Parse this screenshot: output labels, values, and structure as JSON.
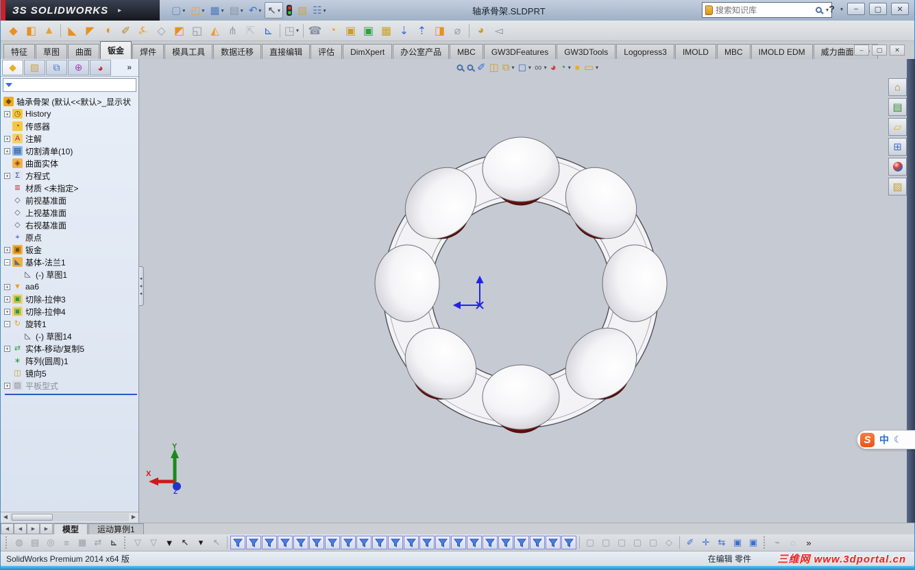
{
  "colors": {
    "accent_blue": "#2a57c8",
    "ball_red": "#8e1f17",
    "cage_white": "#f3f3f6",
    "viewport_bg": "#c6cad3",
    "titlebar_dark": "#15181f",
    "logo_red": "#cc2127",
    "watermark_red": "#e02828"
  },
  "titlebar": {
    "logo": "ЗS SOLIDWORKS",
    "logo_arrow": "▸",
    "title": "轴承骨架.SLDPRT",
    "search": {
      "placeholder": "搜索知识库"
    },
    "help": "?",
    "help_caret": "▾",
    "window_controls": {
      "minimize": "–",
      "restore": "▢",
      "close": "✕"
    }
  },
  "standard_toolbar": {
    "items": [
      {
        "name": "new-document",
        "g": "▢",
        "c": "#6a87b8",
        "caret": "▾"
      },
      {
        "name": "open",
        "g": "◰",
        "c": "#e8a33d",
        "caret": "▾"
      },
      {
        "name": "save",
        "g": "▦",
        "c": "#4f78c0",
        "caret": "▾"
      },
      {
        "name": "print",
        "g": "▤",
        "c": "#8a93a5",
        "caret": "▾"
      },
      {
        "name": "undo",
        "g": "↶",
        "c": "#3f6fd0",
        "caret": "▾"
      },
      {
        "name": "select",
        "g": "↖",
        "c": "#444a55",
        "caret": "▾",
        "boxed": true
      },
      {
        "name": "rebuild-traffic-light",
        "g": "",
        "c": "",
        "caret": "",
        "traffic": true
      },
      {
        "name": "file-properties",
        "g": "▧",
        "c": "#caa44a",
        "caret": ""
      },
      {
        "name": "options",
        "g": "☷",
        "c": "#5a79b5",
        "caret": "▾"
      }
    ]
  },
  "sheetmetal_toolbar": {
    "items": [
      {
        "name": "base-flange",
        "g": "◆",
        "c": "#e89020"
      },
      {
        "name": "convert-to-sheetmetal",
        "g": "◧",
        "c": "#e89020"
      },
      {
        "name": "lofted-bend",
        "g": "▲",
        "c": "#e8a030"
      },
      {
        "name": "sep",
        "g": "",
        "c": "",
        "sep": true
      },
      {
        "name": "edge-flange",
        "g": "◣",
        "c": "#e89020"
      },
      {
        "name": "miter-flange",
        "g": "◤",
        "c": "#e89020"
      },
      {
        "name": "hem",
        "g": "◖",
        "c": "#e89020"
      },
      {
        "name": "sketched-bend",
        "g": "✐",
        "c": "#b0882a"
      },
      {
        "name": "jog",
        "g": "⍼",
        "c": "#e8a030"
      },
      {
        "name": "swept-flange",
        "g": "◇",
        "c": "#98a0aa"
      },
      {
        "name": "cross-break",
        "g": "◩",
        "c": "#e89020"
      },
      {
        "name": "closed-corner",
        "g": "◱",
        "c": "#8a93a0"
      },
      {
        "name": "welded-corner",
        "g": "◭",
        "c": "#e8a030"
      },
      {
        "name": "corner-relief",
        "g": "⋔",
        "c": "#98a0aa"
      },
      {
        "name": "break-corner",
        "g": "⇱",
        "c": "#b8bec6"
      },
      {
        "name": "corner-trim",
        "g": "⊾",
        "c": "#3a6fd0"
      },
      {
        "name": "sep",
        "g": "",
        "c": "",
        "sep": true
      },
      {
        "name": "extruded-cut",
        "g": "◳",
        "c": "#98a0aa",
        "caret": "▾"
      },
      {
        "name": "sep",
        "g": "",
        "c": "",
        "sep": true
      },
      {
        "name": "simple-hole",
        "g": "☎",
        "c": "#8a93a0"
      },
      {
        "name": "vent",
        "g": "◔",
        "c": "#e8a030"
      },
      {
        "name": "unfold",
        "g": "▣",
        "c": "#c8a020"
      },
      {
        "name": "fold",
        "g": "▣",
        "c": "#30a040"
      },
      {
        "name": "flatten-pattern",
        "g": "▦",
        "c": "#c8a020"
      },
      {
        "name": "insert-bends",
        "g": "⇣",
        "c": "#3a6fd0"
      },
      {
        "name": "rip",
        "g": "⇡",
        "c": "#3a6fd0"
      },
      {
        "name": "no-bends",
        "g": "◨",
        "c": "#e89020"
      },
      {
        "name": "forming-tool",
        "g": "⌀",
        "c": "#98a0aa"
      },
      {
        "name": "sep",
        "g": "",
        "c": "",
        "sep": true
      },
      {
        "name": "sheet-metal-gusset",
        "g": "◕",
        "c": "#c8a020"
      },
      {
        "name": "tab-and-slot",
        "g": "◅",
        "c": "#8a93a0"
      }
    ]
  },
  "command_tabs": {
    "items": [
      {
        "label": "特征",
        "active": false
      },
      {
        "label": "草图",
        "active": false
      },
      {
        "label": "曲面",
        "active": false
      },
      {
        "label": "钣金",
        "active": true
      },
      {
        "label": "焊件",
        "active": false
      },
      {
        "label": "模具工具",
        "active": false
      },
      {
        "label": "数据迁移",
        "active": false
      },
      {
        "label": "直接编辑",
        "active": false
      },
      {
        "label": "评估",
        "active": false
      },
      {
        "label": "DimXpert",
        "active": false
      },
      {
        "label": "办公室产品",
        "active": false
      },
      {
        "label": "MBC",
        "active": false
      },
      {
        "label": "GW3DFeatures",
        "active": false
      },
      {
        "label": "GW3DTools",
        "active": false
      },
      {
        "label": "Logopress3",
        "active": false
      },
      {
        "label": "IMOLD",
        "active": false
      },
      {
        "label": "MBC",
        "active": false
      },
      {
        "label": "IMOLD EDM",
        "active": false
      },
      {
        "label": "威力曲面设计",
        "active": false
      }
    ]
  },
  "doc_controls": {
    "minimize": "–",
    "restore": "▢",
    "close": "✕"
  },
  "feature_tree": {
    "tabs": [
      {
        "name": "featuremanager-tab",
        "g": "◆",
        "c": "#e8b020",
        "active": true
      },
      {
        "name": "propertymanager-tab",
        "g": "▧",
        "c": "#caa44a",
        "active": false
      },
      {
        "name": "configurationmanager-tab",
        "g": "⧉",
        "c": "#4a78c8",
        "active": false
      },
      {
        "name": "dimxpertmanager-tab",
        "g": "⊕",
        "c": "#a040c0",
        "active": false
      },
      {
        "name": "displaymanager-tab",
        "g": "◕",
        "c": "#c03030",
        "active": false
      }
    ],
    "chevron": "»",
    "root_label": "轴承骨架  (默认<<默认>_显示状",
    "items": [
      {
        "expand": "+",
        "g": "◷",
        "bg": "#f5c842",
        "fg": "#7a4a00",
        "label": "History",
        "ml": 0
      },
      {
        "expand": "",
        "g": "◔",
        "bg": "#f5c842",
        "fg": "#7a4a00",
        "label": "传感器",
        "ml": 0
      },
      {
        "expand": "+",
        "g": "A",
        "bg": "#f5d06a",
        "fg": "#c02020",
        "label": "注解",
        "ml": 0
      },
      {
        "expand": "+",
        "g": "▤",
        "bg": "#86b4e8",
        "fg": "#1a3a6a",
        "label": "切割清单(10)",
        "ml": 0
      },
      {
        "expand": "",
        "g": "◈",
        "bg": "#f5b14a",
        "fg": "#8a4a00",
        "label": "曲面实体",
        "ml": 0
      },
      {
        "expand": "+",
        "g": "Σ",
        "bg": "#e2e6ee",
        "fg": "#2a4ab0",
        "label": "方程式",
        "ml": 0
      },
      {
        "expand": "",
        "g": "≣",
        "bg": "",
        "fg": "#c03030",
        "label": "材质 <未指定>",
        "ml": 0
      },
      {
        "expand": "",
        "g": "◇",
        "bg": "",
        "fg": "#4a5568",
        "label": "前视基准面",
        "ml": 0
      },
      {
        "expand": "",
        "g": "◇",
        "bg": "",
        "fg": "#4a5568",
        "label": "上视基准面",
        "ml": 0
      },
      {
        "expand": "",
        "g": "◇",
        "bg": "",
        "fg": "#4a5568",
        "label": "右视基准面",
        "ml": 0
      },
      {
        "expand": "",
        "g": "⌖",
        "bg": "",
        "fg": "#3050c8",
        "label": "原点",
        "ml": 0
      },
      {
        "expand": "+",
        "g": "▣",
        "bg": "#f0b23e",
        "fg": "#7a4a00",
        "label": "钣金",
        "ml": 0
      },
      {
        "expand": "−",
        "g": "◣",
        "bg": "#f0b23e",
        "fg": "#6a6f78",
        "label": "基体-法兰1",
        "ml": 0
      },
      {
        "expand": "",
        "g": "◺",
        "bg": "",
        "fg": "#3a424e",
        "label": "(-) 草图1",
        "ml": 16
      },
      {
        "expand": "+",
        "g": "▼",
        "bg": "",
        "fg": "#e8a020",
        "label": "aa6",
        "ml": 0
      },
      {
        "expand": "+",
        "g": "▣",
        "bg": "#f5d06a",
        "fg": "#2a9a3a",
        "label": "切除-拉伸3",
        "ml": 0
      },
      {
        "expand": "+",
        "g": "▣",
        "bg": "#f5d06a",
        "fg": "#2a9a3a",
        "label": "切除-拉伸4",
        "ml": 0
      },
      {
        "expand": "−",
        "g": "↻",
        "bg": "",
        "fg": "#e8a020",
        "label": "旋转1",
        "ml": 0
      },
      {
        "expand": "",
        "g": "◺",
        "bg": "",
        "fg": "#3a424e",
        "label": "(-) 草图14",
        "ml": 16
      },
      {
        "expand": "+",
        "g": "⇄",
        "bg": "",
        "fg": "#2a9a3a",
        "label": "实体-移动/复制5",
        "ml": 0
      },
      {
        "expand": "",
        "g": "∗",
        "bg": "",
        "fg": "#2a9a3a",
        "label": "阵列(圆周)1",
        "ml": 0
      },
      {
        "expand": "",
        "g": "◫",
        "bg": "",
        "fg": "#caa020",
        "label": "镜向5",
        "ml": 0
      },
      {
        "expand": "+",
        "g": "▨",
        "bg": "#d8dce2",
        "fg": "#8a9099",
        "label": "平板型式",
        "ml": 0,
        "gray": true
      }
    ]
  },
  "headsup": {
    "items": [
      {
        "name": "zoom-to-fit",
        "g": "",
        "c": "",
        "caret": "",
        "mag": true
      },
      {
        "name": "zoom-to-area",
        "g": "",
        "c": "",
        "caret": "",
        "mag": true
      },
      {
        "name": "magnified-selection",
        "g": "✐",
        "c": "#3a6fd0",
        "caret": ""
      },
      {
        "name": "section-view",
        "g": "◫",
        "c": "#caa030",
        "caret": ""
      },
      {
        "name": "view-orientation",
        "g": "⧉",
        "c": "#caa030",
        "caret": "▾"
      },
      {
        "name": "display-style",
        "g": "◻",
        "c": "#4a78c8",
        "caret": "▾"
      },
      {
        "name": "hide-show-items",
        "g": "∞",
        "c": "#5a6270",
        "caret": "▾"
      },
      {
        "name": "edit-appearance",
        "g": "◕",
        "c": "#cc4040",
        "caret": ""
      },
      {
        "name": "apply-scene",
        "g": "◔",
        "c": "#3aa050",
        "caret": "▾"
      },
      {
        "name": "view-settings",
        "g": "●",
        "c": "#e8b020",
        "caret": ""
      },
      {
        "name": "camera",
        "g": "▭",
        "c": "#caa030",
        "caret": "▾"
      }
    ]
  },
  "right_rail": {
    "items": [
      {
        "name": "solidworks-resources",
        "g": "⌂",
        "c": "#b8862a",
        "ball": false
      },
      {
        "name": "design-library",
        "g": "▤",
        "c": "#3a8a3a",
        "ball": false
      },
      {
        "name": "file-explorer",
        "g": "▱",
        "c": "#e8b020",
        "ball": false
      },
      {
        "name": "view-palette",
        "g": "⊞",
        "c": "#4a6fd0",
        "ball": false
      },
      {
        "name": "appearances-scenes",
        "g": "",
        "c": "",
        "ball": true
      },
      {
        "name": "custom-properties",
        "g": "▨",
        "c": "#caa030",
        "ball": false
      }
    ]
  },
  "viewport": {
    "triad": {
      "x_label": "X",
      "y_label": "Y",
      "z_label": "Z"
    },
    "ime": {
      "logo": "S",
      "lang": "中",
      "moon": "☾"
    }
  },
  "bottom_tabs": {
    "nav": [
      {
        "g": "◀"
      },
      {
        "g": "◀"
      },
      {
        "g": "▶"
      },
      {
        "g": "▶"
      }
    ],
    "items": [
      {
        "label": "模型",
        "active": true
      },
      {
        "label": "运动算例1",
        "active": false
      }
    ]
  },
  "filter_toolbar": {
    "g1": [
      {
        "name": "isolate",
        "g": "◍",
        "gray": true
      },
      {
        "name": "hide-bodies",
        "g": "▤",
        "gray": true
      },
      {
        "name": "appearance-toggle",
        "g": "◎",
        "gray": true
      },
      {
        "name": "display-states",
        "g": "≡",
        "gray": true
      },
      {
        "name": "mesh-preview",
        "g": "▦",
        "gray": true
      },
      {
        "name": "compare",
        "g": "⇄",
        "gray": true
      },
      {
        "name": "origin-toggle",
        "g": "⊾",
        "gray": false,
        "framed": true
      }
    ],
    "g2": [
      {
        "name": "clear-filters",
        "g": "▽",
        "gray": true
      },
      {
        "name": "clear-all-filters",
        "g": "▽",
        "gray": true
      },
      {
        "name": "toggle-filters",
        "g": "▼",
        "gray": false
      },
      {
        "name": "select-arrow",
        "g": "↖",
        "gray": false,
        "framed": true
      },
      {
        "name": "select-caret",
        "g": "▾",
        "gray": false
      },
      {
        "name": "select-other",
        "g": "↖",
        "gray": true
      }
    ],
    "g3_count": 22,
    "g4": [
      {
        "name": "filter-cube-1",
        "g": "▢",
        "gray": true
      },
      {
        "name": "filter-cube-2",
        "g": "▢",
        "gray": true
      },
      {
        "name": "filter-cube-3",
        "g": "▢",
        "gray": true
      },
      {
        "name": "filter-cube-4",
        "g": "▢",
        "gray": true
      },
      {
        "name": "filter-cube-5",
        "g": "▢",
        "gray": true
      },
      {
        "name": "filter-cube-6",
        "g": "◇",
        "gray": true
      }
    ],
    "g5": [
      {
        "name": "sketch-entities-filter",
        "g": "✐",
        "gray": false
      },
      {
        "name": "add-filter",
        "g": "✛",
        "gray": true
      },
      {
        "name": "route-filter",
        "g": "⇆",
        "gray": false
      },
      {
        "name": "block-filter-1",
        "g": "▣",
        "gray": false
      },
      {
        "name": "block-filter-2",
        "g": "▣",
        "gray": false
      }
    ],
    "g6": [
      {
        "name": "weld-filter",
        "g": "⌁",
        "gray": true
      },
      {
        "name": "ring-filter",
        "g": "◌",
        "gray": true
      },
      {
        "name": "more-chevron",
        "g": "»",
        "gray": false
      }
    ]
  },
  "statusbar": {
    "left": "SolidWorks Premium 2014 x64 版",
    "editing": "在编辑 零件",
    "watermark": "三维网 www.3dportal.cn"
  }
}
